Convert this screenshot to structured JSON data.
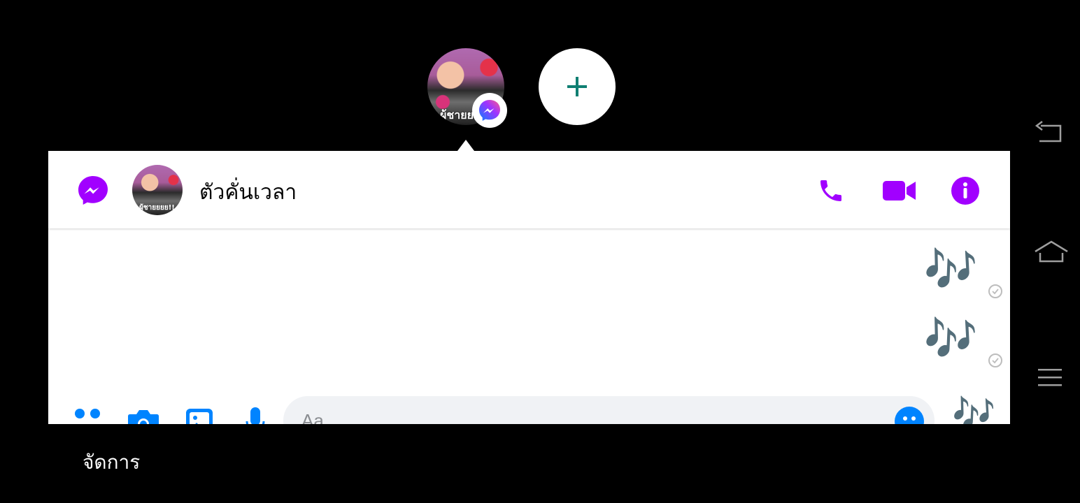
{
  "chat_heads": {
    "avatar_caption": "ผู้ชายย",
    "add_icon": "plus-icon"
  },
  "conversation": {
    "title": "ตัวคั่นเวลา",
    "avatar_caption": "ผู้ชายยยย!!",
    "header_icons": [
      "messenger-logo-icon",
      "phone-icon",
      "video-camera-icon",
      "info-icon"
    ],
    "accent_color": "#a100ff",
    "messages": [
      {
        "text": "🎶",
        "status": "sent"
      },
      {
        "text": "🎶",
        "status": "sent"
      }
    ]
  },
  "composer": {
    "placeholder": "Aa",
    "icons": [
      "apps-icon",
      "camera-icon",
      "gallery-icon",
      "microphone-icon",
      "emoji-icon"
    ],
    "quick_reaction": "🎶"
  },
  "footer": {
    "manage_label": "จัดการ"
  },
  "system_nav": [
    "back-icon",
    "home-icon",
    "menu-icon"
  ]
}
